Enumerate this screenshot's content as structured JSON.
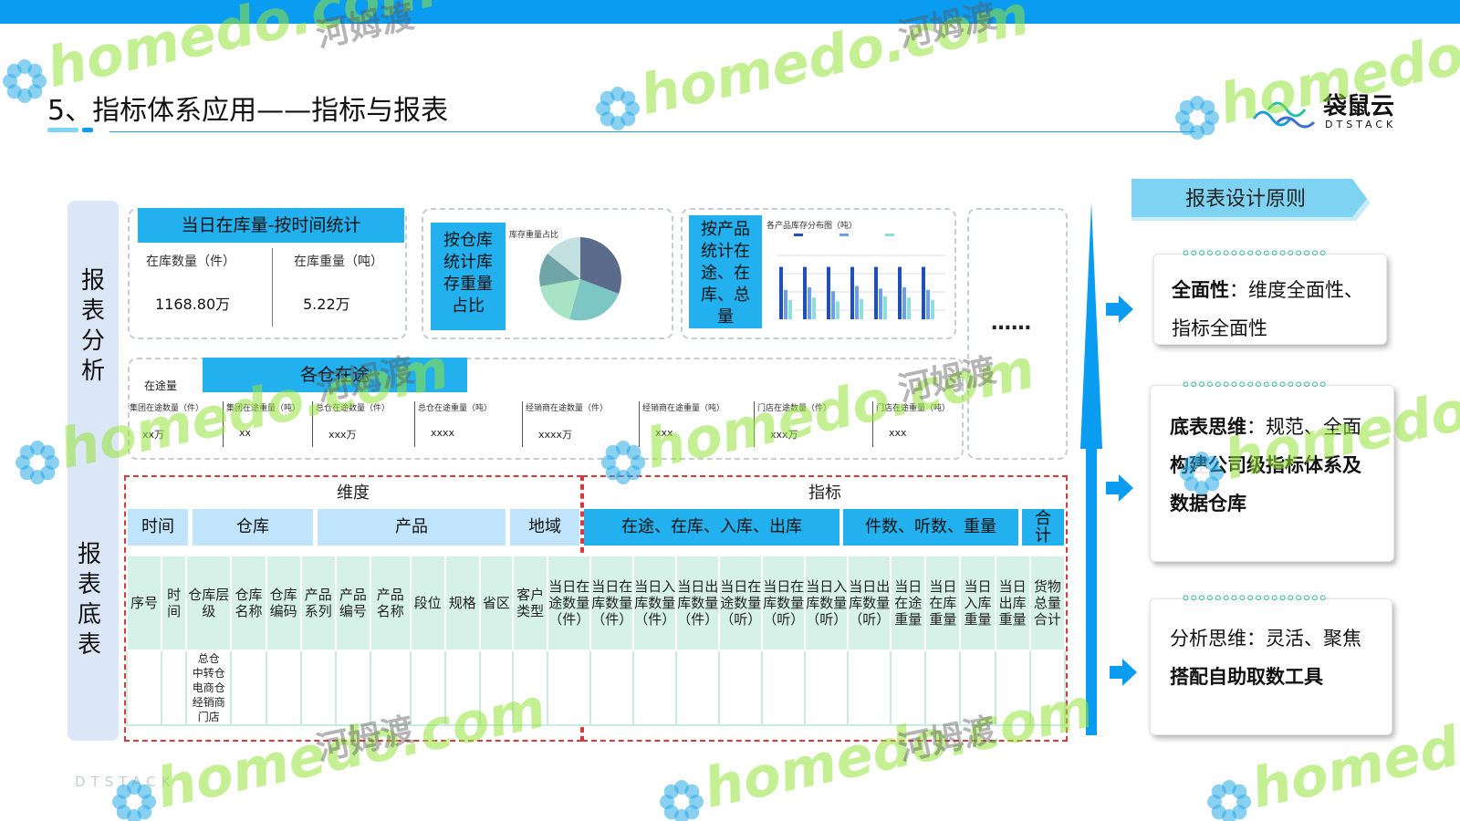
{
  "header": {
    "title": "5、指标体系应用——指标与报表",
    "logo_name": "袋鼠云",
    "logo_sub": "DTSTACK",
    "footer_brand": "DTSTACK"
  },
  "side_labels": {
    "top": [
      "报",
      "表",
      "分",
      "析"
    ],
    "bottom": [
      "报",
      "表",
      "底",
      "表"
    ]
  },
  "report_analysis": {
    "inventory_card": {
      "banner": "当日在库量-按时间统计",
      "col1_label": "在库数量（件）",
      "col1_value": "1168.80万",
      "col2_label": "在库重量（吨）",
      "col2_value": "5.22万"
    },
    "pie_card": {
      "label": "按仓库统计库存重量占比",
      "mini_title": "库存重量占比"
    },
    "bar_card": {
      "label": "按产品统计在途、在库、总量",
      "mini_title": "各产品库存分布图（吨）"
    },
    "more": "……",
    "transit_card": {
      "banner": "各仓在途",
      "sub_label": "在途量",
      "fields": [
        {
          "label": "集团在途数量（件）",
          "value": "xx万"
        },
        {
          "label": "集团在途重量（吨）",
          "value": "xx"
        },
        {
          "label": "总仓在途数量（件）",
          "value": "xxx万"
        },
        {
          "label": "总仓在途重量（吨）",
          "value": "xxxx"
        },
        {
          "label": "经销商在途数量（件）",
          "value": "xxxx万"
        },
        {
          "label": "经销商在途重量（吨）",
          "value": "xxx"
        },
        {
          "label": "门店在途数量（件）",
          "value": "xxx万"
        },
        {
          "label": "门店在途重量（吨）",
          "value": "xxx"
        }
      ]
    }
  },
  "base_table": {
    "dimension_title": "维度",
    "metric_title": "指标",
    "dimension_groups": [
      "时间",
      "仓库",
      "产品",
      "地域"
    ],
    "metric_groups": [
      "在途、在库、入库、出库",
      "件数、听数、重量",
      "合计"
    ],
    "columns": [
      "序号",
      "时间",
      "仓库层级",
      "仓库名称",
      "仓库编码",
      "产品系列",
      "产品编号",
      "产品名称",
      "段位",
      "规格",
      "省区",
      "客户类型",
      "当日在途数量（件）",
      "当日在库数量（件）",
      "当日入库数量（件）",
      "当日出库数量（件）",
      "当日在途数量（听）",
      "当日在库数量（听）",
      "当日入库数量（听）",
      "当日出库数量（听）",
      "当日在途重量",
      "当日在库重量",
      "当日入库重量",
      "当日出库重量",
      "货物总量合计"
    ],
    "warehouse_levels": [
      "总仓",
      "中转仓",
      "电商仓",
      "经销商",
      "门店"
    ]
  },
  "principles": {
    "banner": "报表设计原则",
    "cards": [
      {
        "bold": "全面性",
        "rest": "：维度全面性、",
        "line2": "指标全面性",
        "line3": ""
      },
      {
        "bold": "底表思维",
        "rest": "：规范、全面",
        "line2": "构建公司级指标体系及",
        "line3": "数据仓库"
      },
      {
        "bold": "",
        "rest": "分析思维：灵活、聚焦",
        "line2": "搭配自助取数工具",
        "line3": ""
      }
    ]
  },
  "watermark": {
    "latin": "homedo.com",
    "cn": "河姆渡"
  },
  "colors": {
    "accent_blue": "#22b1ee",
    "header_blue": "#0a9cf0",
    "table_green": "#d6f2e8",
    "dashed_red": "#d83a3a"
  }
}
